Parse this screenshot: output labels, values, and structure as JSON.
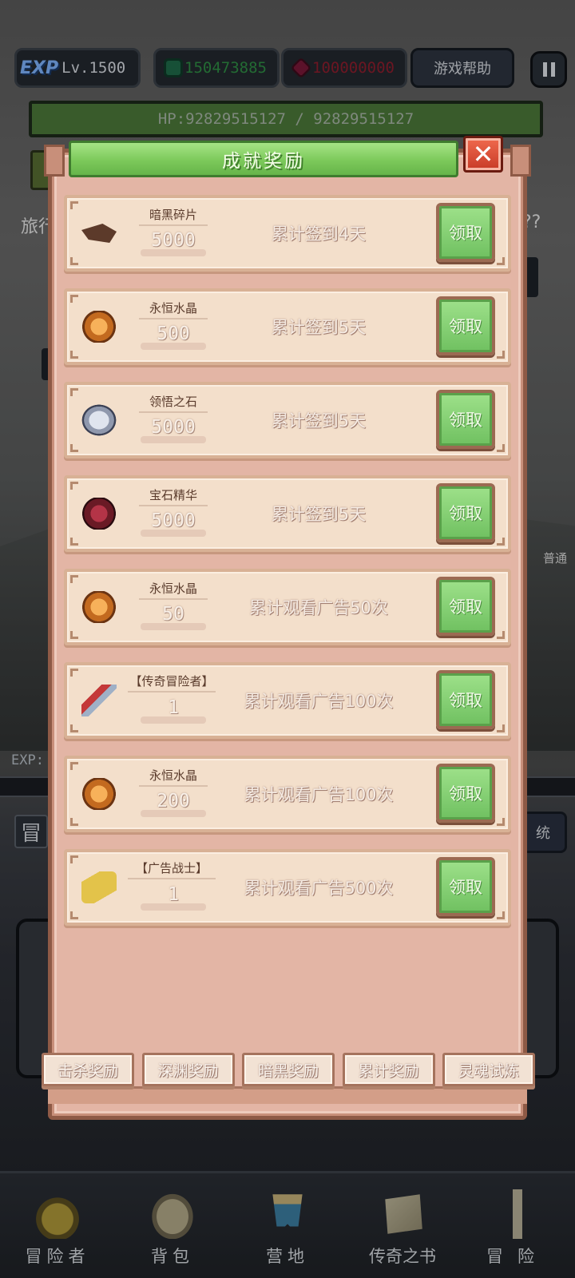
{
  "hud": {
    "exp_logo": "EXP",
    "level": "Lv.1500",
    "green_currency": "150473885",
    "red_currency": "100000000",
    "help_label": "游戏帮助",
    "hp": "HP:92829515127 / 92829515127"
  },
  "background": {
    "left_text": "旅行",
    "right_text": "??",
    "side_text": "普通",
    "exp_label": "EXP:",
    "mao_char": "冒",
    "tong_char": "统"
  },
  "modal": {
    "title": "成就奖励",
    "close_symbol": "✕",
    "rewards": [
      {
        "item": "暗黑碎片",
        "qty": "5000",
        "condition": "累计签到4天",
        "button": "领取",
        "icon": "dark-shard-icon"
      },
      {
        "item": "永恒水晶",
        "qty": "500",
        "condition": "累计签到5天",
        "button": "领取",
        "icon": "eternal-crystal-icon"
      },
      {
        "item": "领悟之石",
        "qty": "5000",
        "condition": "累计签到5天",
        "button": "领取",
        "icon": "insight-stone-icon"
      },
      {
        "item": "宝石精华",
        "qty": "5000",
        "condition": "累计签到5天",
        "button": "领取",
        "icon": "gem-essence-icon"
      },
      {
        "item": "永恒水晶",
        "qty": "50",
        "condition": "累计观看广告50次",
        "button": "领取",
        "icon": "eternal-crystal-icon"
      },
      {
        "item": "【传奇冒险者】",
        "qty": "1",
        "condition": "累计观看广告100次",
        "button": "领取",
        "icon": "legend-sword-icon"
      },
      {
        "item": "永恒水晶",
        "qty": "200",
        "condition": "累计观看广告100次",
        "button": "领取",
        "icon": "eternal-crystal-icon"
      },
      {
        "item": "【广告战士】",
        "qty": "1",
        "condition": "累计观看广告500次",
        "button": "领取",
        "icon": "scroll-icon"
      }
    ],
    "tabs": [
      "击杀奖励",
      "深渊奖励",
      "暗黑奖励",
      "累计奖励",
      "灵魂试炼"
    ]
  },
  "nav": {
    "items": [
      {
        "label": "冒险者",
        "icon": "helmet-icon"
      },
      {
        "label": "背包",
        "icon": "backpack-icon"
      },
      {
        "label": "营地",
        "icon": "camp-banner-icon"
      },
      {
        "label": "传奇之书",
        "icon": "book-icon"
      },
      {
        "label": "冒险",
        "icon": "sword-icon"
      }
    ]
  }
}
